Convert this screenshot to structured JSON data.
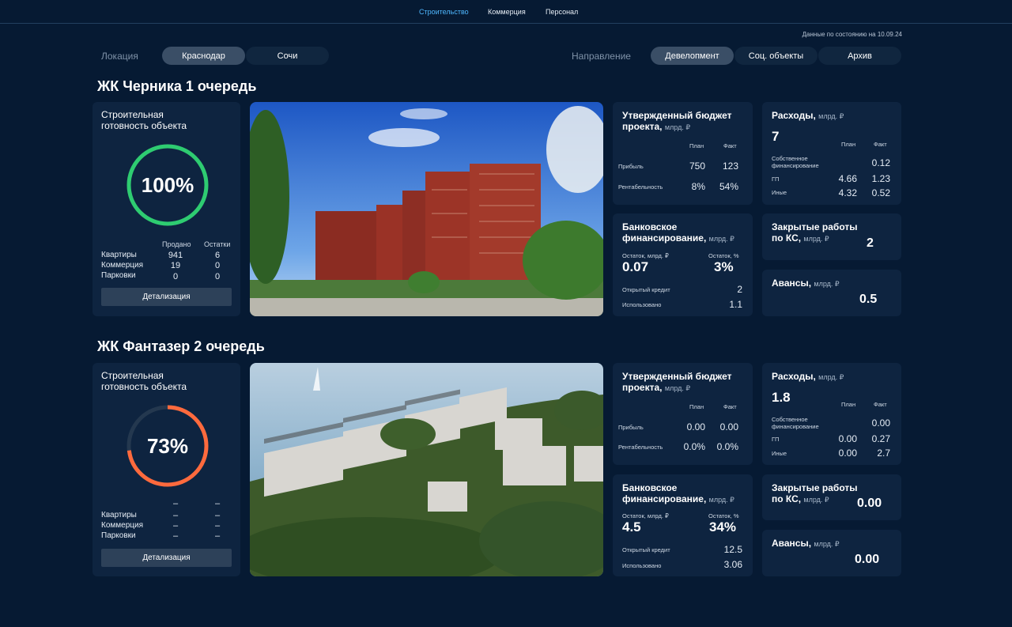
{
  "nav": {
    "tabs": [
      "Строительство",
      "Коммерция",
      "Персонал"
    ]
  },
  "date_note": "Данные по состоянию на 10.09.24",
  "filters": {
    "location_label": "Локация",
    "locations": [
      "Краснодар",
      "Сочи"
    ],
    "direction_label": "Направление",
    "directions": [
      "Девелопмент",
      "Соц. объекты",
      "Архив"
    ]
  },
  "labels": {
    "ready": "Строительная готовность объекта",
    "sold": "Продано",
    "left": "Остатки",
    "rows": [
      "Квартиры",
      "Коммерция",
      "Парковки"
    ],
    "detail": "Детализация",
    "budget": "Утвержденный бюджет проекта,",
    "unit_bln": "млрд. ₽",
    "plan": "План",
    "fact": "Факт",
    "profit": "Прибыль",
    "profitability": "Рентабельность",
    "expenses": "Расходы,",
    "own": "Собственное финансирование",
    "gp": "ГП",
    "other": "Иные",
    "bank": "Банковское финансирование,",
    "balance_bln": "Остаток, млрд. ₽",
    "balance_pct": "Остаток, %",
    "open_credit": "Открытый кредит",
    "used": "Использовано",
    "closed_works": "Закрытые работы по КС,",
    "advances": "Авансы,"
  },
  "projects": [
    {
      "title": "ЖК Черника 1 очередь",
      "ready_pct": "100%",
      "ready_value": 1.0,
      "ring_color": "#2ecc71",
      "sold": [
        "941",
        "19",
        "0"
      ],
      "left": [
        "6",
        "0",
        "0"
      ],
      "budget": {
        "profit_plan": "750",
        "profit_fact": "123",
        "prof_plan": "8%",
        "prof_fact": "54%"
      },
      "expenses": {
        "total": "7",
        "own_fact": "0.12",
        "gp_plan": "4.66",
        "gp_fact": "1.23",
        "other_plan": "4.32",
        "other_fact": "0.52"
      },
      "bank": {
        "balance": "0.07",
        "balance_pct": "3%",
        "open_credit": "2",
        "used": "1.1"
      },
      "closed_works": "2",
      "advances": "0.5"
    },
    {
      "title": "ЖК Фантазер 2 очередь",
      "ready_pct": "73%",
      "ready_value": 0.73,
      "ring_color": "#ff6a3d",
      "sold": [
        "–",
        "–",
        "–"
      ],
      "left": [
        "–",
        "–",
        "–"
      ],
      "sold_head": "–",
      "left_head": "–",
      "budget": {
        "profit_plan": "0.00",
        "profit_fact": "0.00",
        "prof_plan": "0.0%",
        "prof_fact": "0.0%"
      },
      "expenses": {
        "total": "1.8",
        "own_fact": "0.00",
        "gp_plan": "0.00",
        "gp_fact": "0.27",
        "other_plan": "0.00",
        "other_fact": "2.7"
      },
      "bank": {
        "balance": "4.5",
        "balance_pct": "34%",
        "open_credit": "12.5",
        "used": "3.06"
      },
      "closed_works": "0.00",
      "advances": "0.00"
    }
  ]
}
